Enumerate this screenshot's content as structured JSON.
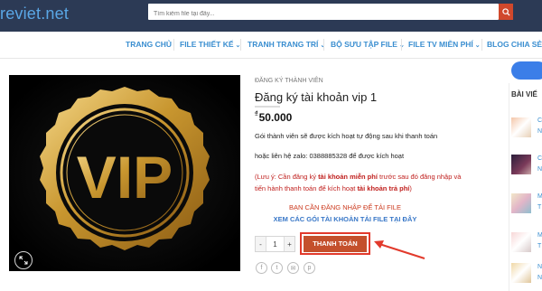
{
  "header": {
    "logo_text": "reviet.net",
    "search_placeholder": "Tìm kiếm file tại đây...",
    "bg_color": "#2c3a55",
    "accent": "#d0482c"
  },
  "nav": {
    "items": [
      {
        "label": "TRANG CHỦ",
        "dropdown": false
      },
      {
        "label": "FILE THIẾT KẾ",
        "dropdown": true
      },
      {
        "label": "TRANH TRANG TRÍ",
        "dropdown": true
      },
      {
        "label": "BỘ SƯU TẬP FILE",
        "dropdown": true
      },
      {
        "label": "FILE TV MIỄN PHÍ",
        "dropdown": true
      },
      {
        "label": "BLOG CHIA SẺ",
        "dropdown": false
      }
    ],
    "text_color": "#3a8ed0"
  },
  "product": {
    "image_text": "VIP",
    "breadcrumb": "ĐĂNG KÝ THÀNH VIÊN",
    "title": "Đăng ký tài khoản vip 1",
    "currency_symbol": "₫",
    "price": "50.000",
    "desc1": "Gói thành viên sẽ được kích hoạt tự động sau khi thanh toán",
    "desc2": "hoặc liên hệ zalo: 0388885328 để được kích hoạt",
    "note_part1": "(Lưu ý: Cần đăng ký ",
    "note_bold1": "tài khoản miễn phí",
    "note_part2": " trước sau đó đăng nhập và tiến hành thanh toán để kích hoạt ",
    "note_bold2": "tài khoản trả phí",
    "note_part3": ")",
    "login_message": "BẠN CẦN ĐĂNG NHẬP ĐỂ TẢI FILE",
    "plans_link": "XEM CÁC GÓI TÀI KHOẢN TẢI FILE TẠI ĐÂY",
    "quantity_minus": "-",
    "quantity_value": "1",
    "quantity_plus": "+",
    "checkout_label": "THANH TOÁN",
    "checkout_color": "#c4502c"
  },
  "share_icons": [
    "facebook-icon",
    "twitter-icon",
    "email-icon",
    "pinterest-icon"
  ],
  "sidebar": {
    "title": "BÀI VIẾ",
    "item_letters": [
      "C",
      "N",
      "C",
      "N",
      "M",
      "T",
      "M",
      "T",
      "N",
      "N"
    ]
  }
}
